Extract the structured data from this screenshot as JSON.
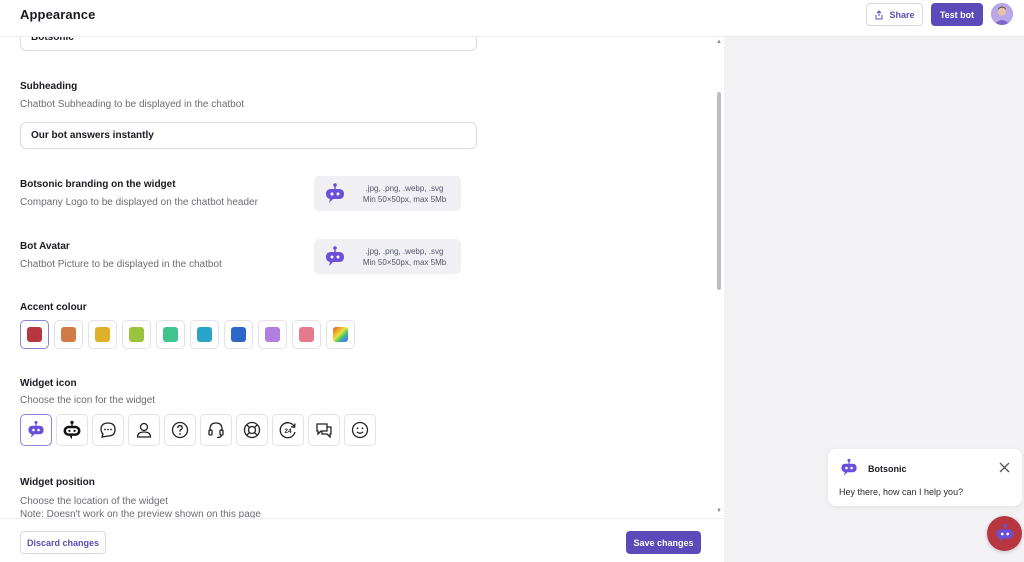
{
  "header": {
    "title": "Appearance",
    "share_label": "Share",
    "test_label": "Test bot"
  },
  "form": {
    "title_value": "Botsonic",
    "subheading": {
      "label": "Subheading",
      "description": "Chatbot Subheading to be displayed in the chatbot",
      "value": "Our bot answers instantly"
    },
    "branding": {
      "label": "Botsonic branding on the widget",
      "description": "Company Logo to be displayed on the chatbot header",
      "upload_line1": ".jpg, .png, .webp, .svg",
      "upload_line2": "Min 50×50px, max 5Mb"
    },
    "avatar": {
      "label": "Bot Avatar",
      "description": "Chatbot Picture to be displayed in the chatbot",
      "upload_line1": ".jpg, .png, .webp, .svg",
      "upload_line2": "Min 50×50px, max 5Mb"
    },
    "accent": {
      "label": "Accent colour",
      "colors": [
        "#b8363f",
        "#d07a45",
        "#e0b02a",
        "#9ac43e",
        "#3fc48e",
        "#2aa3c9",
        "#2f66c9",
        "#b07fe0",
        "#e57a8e",
        "rainbow"
      ],
      "selected_index": 0
    },
    "widget_icon": {
      "label": "Widget icon",
      "description": "Choose the icon for the widget",
      "icons": [
        "bot-face-icon",
        "robot-head-icon",
        "chat-bubble-dots-icon",
        "person-icon",
        "question-circle-icon",
        "headset-icon",
        "lifebuoy-icon",
        "support-24-icon",
        "chat-bubbles-icon",
        "smiley-icon"
      ],
      "selected_index": 0
    },
    "position": {
      "label": "Widget position",
      "description": "Choose the location of the widget",
      "note": "Note: Doesn't work on the preview shown on this page"
    }
  },
  "footer": {
    "discard_label": "Discard changes",
    "save_label": "Save changes"
  },
  "chat_preview": {
    "bot_name": "Botsonic",
    "greeting": "Hey there, how can I help you?"
  },
  "colors": {
    "brand": "#5b4aba",
    "launcher": "#b8363f",
    "bot": "#6b4fd8"
  }
}
